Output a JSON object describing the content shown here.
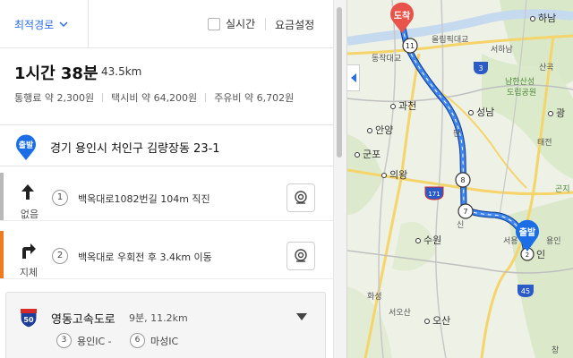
{
  "topbar": {
    "route_option": "최적경로",
    "realtime_label": "실시간",
    "fee_settings_label": "요금설정"
  },
  "summary": {
    "total_time": "1시간 38분",
    "total_distance": "43.5km",
    "toll_fee": "통행료 약 2,300원",
    "taxi_fee": "택시비 약 64,200원",
    "fuel_fee": "주유비 약 6,702원"
  },
  "origin": {
    "badge": "출발",
    "address": "경기 용인시 처인구 김량장동 23-1"
  },
  "steps": [
    {
      "num": "1",
      "text": "백옥대로1082번길 104m 직진",
      "status": "없음",
      "arrow": "straight-arrow-icon",
      "status_color": "#b9b9b9"
    },
    {
      "num": "2",
      "text": "백옥대로 우회전 후 3.4km 이동",
      "status": "지체",
      "arrow": "turn-right-arrow-icon",
      "status_color": "#f07a1e"
    }
  ],
  "highway": {
    "shield_number": "50",
    "name": "영동고속도로",
    "meta": "9분, 11.2km",
    "ic_a_num": "3",
    "ic_a_label": "용인IC -",
    "ic_b_num": "6",
    "ic_b_label": "마성IC"
  },
  "map": {
    "dest_badge": "도착",
    "origin_badge": "출발",
    "labels": {
      "hanam": "하남",
      "olympic": "올림픽대교",
      "seohanam": "서하남",
      "dongjak": "동작대교",
      "namhansan": "남한산성",
      "provincial_park": "도립공원",
      "sanguk": "산곡",
      "gwacheon": "과천",
      "seongnam": "성남",
      "gwang": "광",
      "anyang": "안양",
      "pan": "판",
      "taejeon": "태전",
      "gunpo": "군포",
      "uiwang": "의왕",
      "ganji": "곤지",
      "suwon": "수원",
      "sin": "신",
      "yongin_in": "인",
      "seoyongin": "서용",
      "yongin_east": "용인",
      "hwaseong": "화성",
      "seoosan": "서오산",
      "osan": "오산",
      "chang": "창"
    },
    "road_shields": {
      "r3": "3",
      "r45": "45",
      "r171": "171",
      "wp11": "11",
      "wp8": "8",
      "wp7": "7",
      "wp2": "2"
    }
  },
  "colors": {
    "accent": "#2b6de6",
    "route": "#2f6fe0",
    "dest_marker": "#e8534a",
    "origin_marker": "#1b6ee6",
    "delay": "#f07a1e"
  }
}
